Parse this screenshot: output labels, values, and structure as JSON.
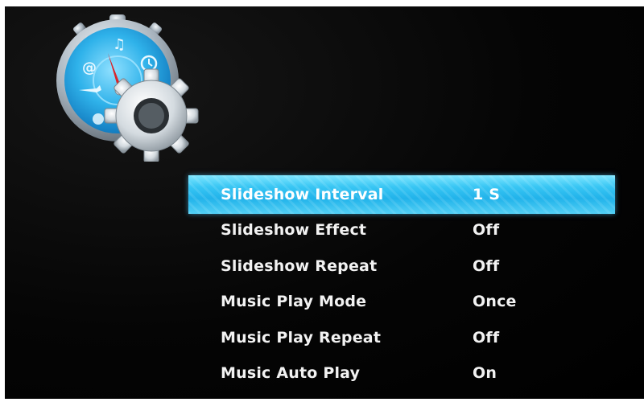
{
  "menu": {
    "items": [
      {
        "label": "Slideshow Interval",
        "value": "1 S",
        "selected": true
      },
      {
        "label": "Slideshow Effect",
        "value": "Off",
        "selected": false
      },
      {
        "label": "Slideshow Repeat",
        "value": "Off",
        "selected": false
      },
      {
        "label": "Music Play Mode",
        "value": "Once",
        "selected": false
      },
      {
        "label": "Music Play Repeat",
        "value": "Off",
        "selected": false
      },
      {
        "label": "Music Auto Play",
        "value": "On",
        "selected": false
      }
    ]
  },
  "icons": {
    "header": "clock-gear-settings-icon"
  },
  "colors": {
    "background": "#000000",
    "highlight": "#2bbcf0",
    "text": "#f2f2f2"
  }
}
